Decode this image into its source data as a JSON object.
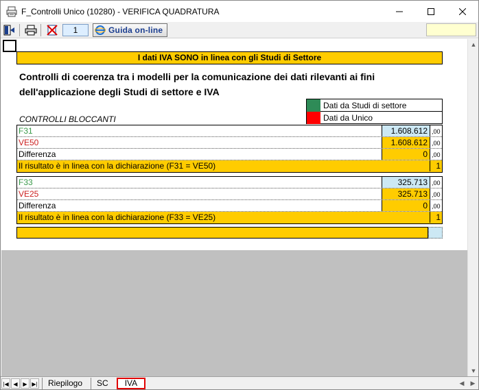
{
  "window": {
    "title": "F_Controlli Unico (10280) - VERIFICA QUADRATURA",
    "minimize": "—",
    "maximize": "☐",
    "close": "✕"
  },
  "toolbar": {
    "page_number": "1",
    "guide_label": "Guida on-line"
  },
  "sheet": {
    "banner": "I dati IVA SONO in linea con gli Studi di Settore",
    "heading": "Controlli di coerenza  tra i modelli per la comunicazione dei dati rilevanti ai fini dell'applicazione degli Studi di settore e IVA",
    "legend": [
      {
        "label": "Dati da Studi di settore",
        "color": "#2e8b57"
      },
      {
        "label": "Dati da Unico",
        "color": "#ff0000"
      }
    ],
    "controls_label": "CONTROLLI BLOCCANTI",
    "blocks": [
      {
        "rows": [
          {
            "label": "F31",
            "value": "1.608.612",
            "dec": ",00"
          },
          {
            "label": "VE50",
            "value": "1.608.612",
            "dec": ",00"
          },
          {
            "label": "Differenza",
            "value": "0",
            "dec": ",00"
          }
        ],
        "result_label": "Il risultato è in linea con la dichiarazione (F31 = VE50)",
        "result_value": "1"
      },
      {
        "rows": [
          {
            "label": "F33",
            "value": "325.713",
            "dec": ",00"
          },
          {
            "label": "VE25",
            "value": "325.713",
            "dec": ",00"
          },
          {
            "label": "Differenza",
            "value": "0",
            "dec": ",00"
          }
        ],
        "result_label": "Il risultato è in linea con la dichiarazione (F33 = VE25)",
        "result_value": "1"
      }
    ]
  },
  "tabs": [
    {
      "label": "Riepilogo"
    },
    {
      "label": "SC"
    },
    {
      "label": "IVA"
    }
  ],
  "colors": {
    "accent_yellow": "#ffcc00",
    "value_blue": "#cce8f4",
    "green_text": "#3a9a4a",
    "red_text": "#cc1f1f",
    "active_tab_border": "#e00000"
  }
}
